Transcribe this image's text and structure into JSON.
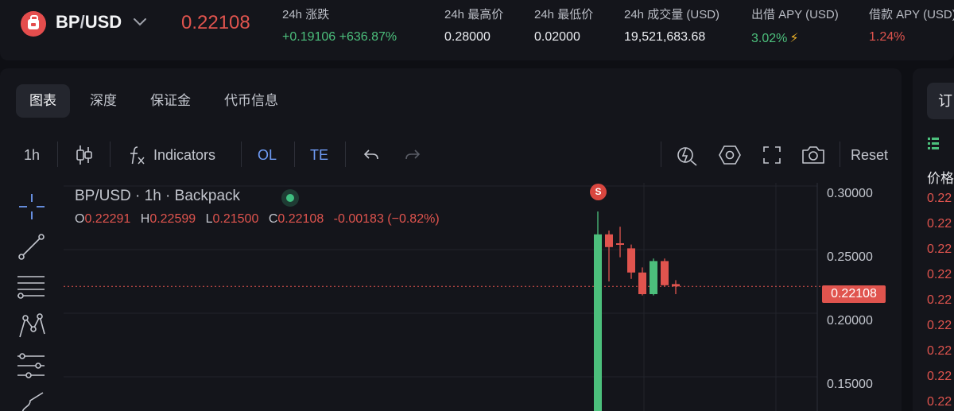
{
  "header": {
    "pair_base": "BP",
    "pair_sep": "/",
    "pair_quote": "USD",
    "last_price": "0.22108",
    "stats": [
      {
        "label": "24h 涨跌",
        "value": "+0.19106 +636.87%",
        "tone": "green"
      },
      {
        "label": "24h 最高价",
        "value": "0.28000",
        "tone": "neutral"
      },
      {
        "label": "24h 最低价",
        "value": "0.02000",
        "tone": "neutral"
      },
      {
        "label": "24h 成交量 (USD)",
        "value": "19,521,683.68",
        "tone": "neutral"
      },
      {
        "label": "出借 APY (USD)",
        "value": "3.02%",
        "tone": "green"
      },
      {
        "label": "借款 APY (USD)",
        "value": "1.24%",
        "tone": "red"
      }
    ]
  },
  "tabs": [
    {
      "label": "图表",
      "active": true
    },
    {
      "label": "深度",
      "active": false
    },
    {
      "label": "保证金",
      "active": false
    },
    {
      "label": "代币信息",
      "active": false
    }
  ],
  "toolbar": {
    "interval": "1h",
    "indicators_label": "Indicators",
    "ol_label": "OL",
    "te_label": "TE",
    "reset_label": "Reset",
    "icons": [
      "candle-type-icon",
      "function-icon",
      "undo-icon",
      "redo-icon",
      "chart-settings-icon",
      "hexagon-settings-icon",
      "fullscreen-icon",
      "camera-icon"
    ]
  },
  "draw_tools": [
    "crosshair-icon",
    "trend-line-icon",
    "horizontal-lines-icon",
    "pattern-icon",
    "fib-lines-icon",
    "brush-icon"
  ],
  "legend": {
    "title": "BP/USD · 1h · Backpack",
    "ohlc": [
      {
        "key": "O",
        "value": "0.22291"
      },
      {
        "key": "H",
        "value": "0.22599"
      },
      {
        "key": "L",
        "value": "0.21500"
      },
      {
        "key": "C",
        "value": "0.22108"
      }
    ],
    "change": "-0.00183 (−0.82%)"
  },
  "signal_badge": "S",
  "chart_data": {
    "type": "candlestick",
    "y_tick_labels": [
      "0.30000",
      "0.25000",
      "0.20000",
      "0.15000"
    ],
    "ylim": [
      0.14,
      0.315
    ],
    "last_price": 0.22108,
    "last_price_label": "0.22108",
    "candles": [
      {
        "open": 0.02,
        "high": 0.28,
        "low": 0.02,
        "close": 0.262,
        "dir": "up"
      },
      {
        "open": 0.262,
        "high": 0.265,
        "low": 0.225,
        "close": 0.252,
        "dir": "down"
      },
      {
        "open": 0.255,
        "high": 0.268,
        "low": 0.244,
        "close": 0.254,
        "dir": "down"
      },
      {
        "open": 0.251,
        "high": 0.254,
        "low": 0.227,
        "close": 0.232,
        "dir": "down"
      },
      {
        "open": 0.232,
        "high": 0.236,
        "low": 0.214,
        "close": 0.215,
        "dir": "down"
      },
      {
        "open": 0.215,
        "high": 0.243,
        "low": 0.214,
        "close": 0.241,
        "dir": "up"
      },
      {
        "open": 0.241,
        "high": 0.243,
        "low": 0.221,
        "close": 0.222,
        "dir": "down"
      },
      {
        "open": 0.2229,
        "high": 0.226,
        "low": 0.215,
        "close": 0.2211,
        "dir": "down"
      }
    ],
    "colors": {
      "up": "#4cbf7c",
      "down": "#e0544e"
    }
  },
  "orderbook": {
    "header": "订",
    "price_col": "价格",
    "rows": [
      "0.22",
      "0.22",
      "0.22",
      "0.22",
      "0.22",
      "0.22",
      "0.22",
      "0.22",
      "0.22"
    ]
  }
}
